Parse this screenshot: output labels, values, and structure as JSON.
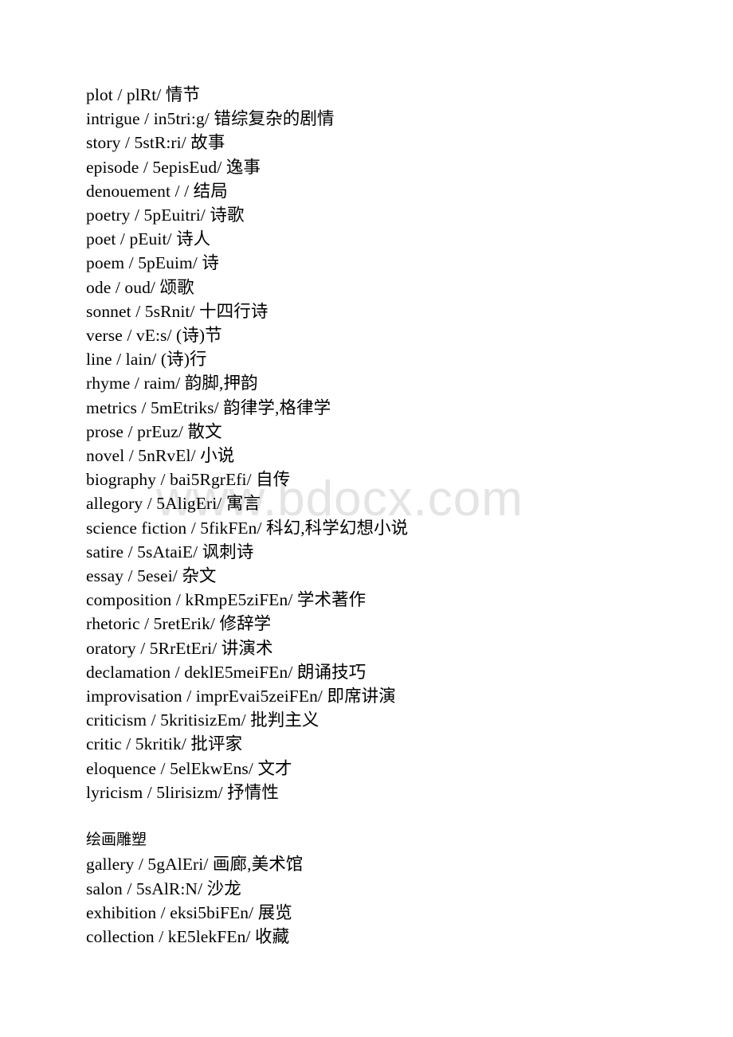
{
  "document": {
    "background_color": "#ffffff",
    "text_color": "#000000",
    "watermark": {
      "text": "www.bdocx.com",
      "color": "#e4e4e4"
    }
  },
  "blocks": [
    {
      "type": "entries",
      "lines": [
        "plot / plRt/ 情节",
        "intrigue / in5tri:g/ 错综复杂的剧情",
        "story / 5stR:ri/ 故事",
        "episode / 5episEud/ 逸事",
        "denouement / / 结局",
        "poetry / 5pEuitri/ 诗歌",
        "poet / pEuit/ 诗人",
        "poem / 5pEuim/ 诗",
        "ode / oud/ 颂歌",
        "sonnet / 5sRnit/ 十四行诗",
        "verse / vE:s/ (诗)节",
        "line / lain/ (诗)行",
        "rhyme / raim/ 韵脚,押韵",
        "metrics / 5mEtriks/ 韵律学,格律学",
        "prose / prEuz/ 散文",
        "novel / 5nRvEl/ 小说",
        "biography / bai5RgrEfi/ 自传",
        "allegory / 5AligEri/ 寓言",
        "science fiction / 5fikFEn/ 科幻,科学幻想小说",
        "satire / 5sAtaiE/ 讽刺诗",
        "essay / 5esei/ 杂文",
        "composition / kRmpE5ziFEn/ 学术著作",
        "rhetoric / 5retErik/ 修辞学",
        "oratory / 5RrEtEri/ 讲演术",
        "declamation / deklE5meiFEn/ 朗诵技巧",
        "improvisation / imprEvai5zeiFEn/ 即席讲演",
        "criticism / 5kritisizEm/ 批判主义",
        "critic / 5kritik/ 批评家",
        "eloquence / 5elEkwEns/ 文才",
        "lyricism / 5lirisizm/ 抒情性"
      ]
    },
    {
      "type": "blank",
      "lines": [
        ""
      ]
    },
    {
      "type": "heading",
      "lines": [
        "绘画雕塑"
      ]
    },
    {
      "type": "entries",
      "lines": [
        "gallery / 5gAlEri/ 画廊,美术馆",
        "salon / 5sAlR:N/ 沙龙",
        "exhibition / eksi5biFEn/ 展览",
        "collection / kE5lekFEn/ 收藏"
      ]
    }
  ]
}
